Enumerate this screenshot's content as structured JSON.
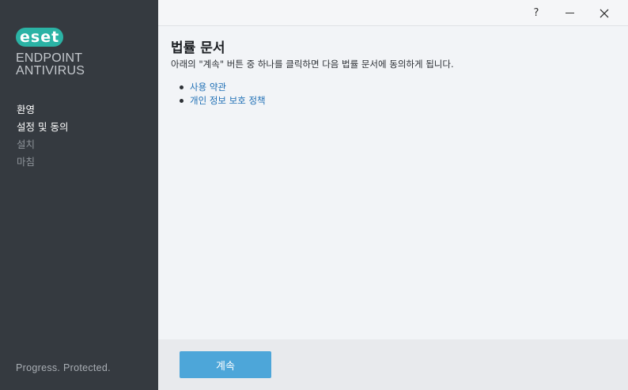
{
  "sidebar": {
    "logo_text": "eset",
    "product_line1": "ENDPOINT",
    "product_line2": "ANTIVIRUS",
    "steps": [
      {
        "label": "환영",
        "state": "done"
      },
      {
        "label": "설정 및 동의",
        "state": "active"
      },
      {
        "label": "설치",
        "state": "pending"
      },
      {
        "label": "마침",
        "state": "pending"
      }
    ],
    "tagline": "Progress. Protected."
  },
  "titlebar": {
    "help_label": "?",
    "close_label": "✕"
  },
  "content": {
    "title": "법률 문서",
    "description": "아래의 \"계속\" 버튼 중 하나를 클릭하면 다음 법률 문서에 동의하게 됩니다.",
    "links": [
      "사용 약관",
      "개인 정보 보호 정책"
    ]
  },
  "footer": {
    "continue_label": "계속"
  },
  "colors": {
    "sidebar_bg": "#353a40",
    "brand_teal": "#2bb3a5",
    "link": "#1f6fb5",
    "button": "#4da6d9"
  }
}
